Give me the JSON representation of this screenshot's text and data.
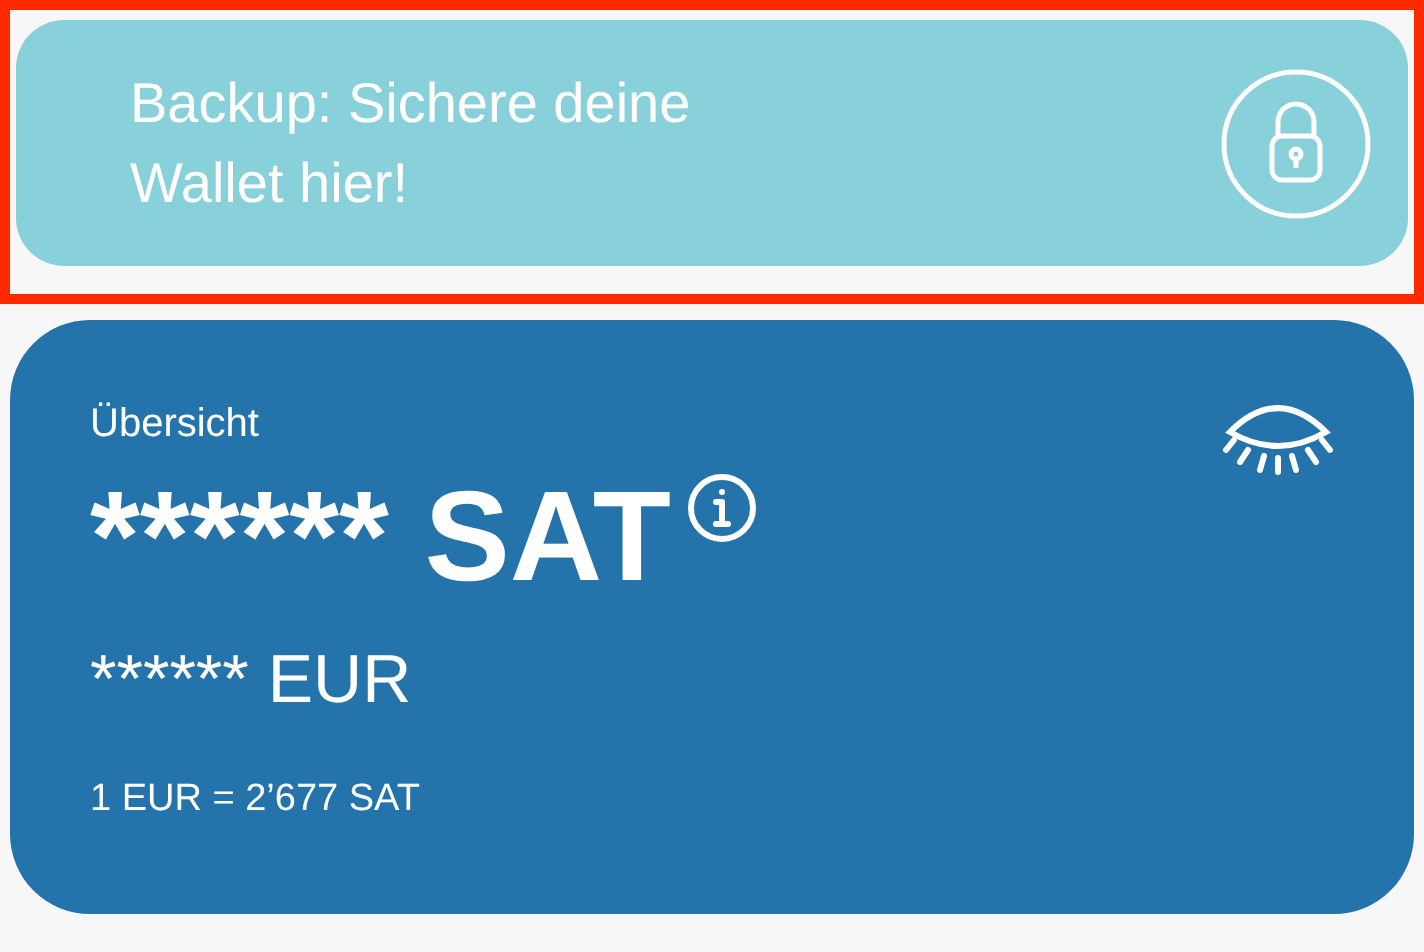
{
  "backup_banner": {
    "text": "Backup: Sichere deine Wallet hier!",
    "highlighted": true
  },
  "overview": {
    "title": "Übersicht",
    "balance_hidden": true,
    "balance": "****** SAT",
    "fiat_balance": "****** EUR",
    "rate": "1 EUR = 2’677 SAT"
  }
}
